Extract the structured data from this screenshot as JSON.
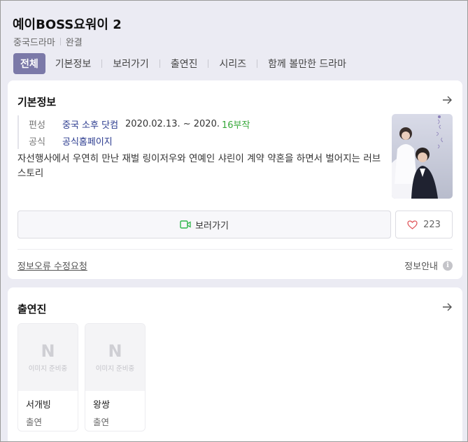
{
  "header": {
    "title": "예이BOSS요워이 2",
    "meta": [
      "중국드라마",
      "완결"
    ]
  },
  "tabs": [
    "전체",
    "기본정보",
    "보러가기",
    "출연진",
    "시리즈",
    "함께 볼만한 드라마"
  ],
  "info": {
    "section_title": "기본정보",
    "broadcast_label": "편성",
    "broadcast_channel": "중국 소후 닷컴",
    "broadcast_dates": "2020.02.13. ~ 2020.",
    "episode_count": "16부작",
    "official_label": "공식",
    "official_link": "공식홈페이지",
    "synopsis": "자선행사에서 우연히 만난 재벌 링이저우와 연예인 샤린이 계약 약혼을 하면서 벌어지는 러브 스토리",
    "watch_label": "보러가기",
    "like_count": "223",
    "report_label": "정보오류 수정요청",
    "guide_label": "정보안내"
  },
  "cast": {
    "section_title": "출연진",
    "placeholder_text": "이미지 준비중",
    "placeholder_letter": "N",
    "members": [
      {
        "name": "서개빙",
        "role": "출연"
      },
      {
        "name": "왕쌍",
        "role": "출연"
      }
    ]
  },
  "colors": {
    "background": "#ebebf3",
    "active_tab": "#7b79a8",
    "link": "#2b3b8f",
    "episode_green": "#37a83a",
    "heart": "#e0565b"
  }
}
